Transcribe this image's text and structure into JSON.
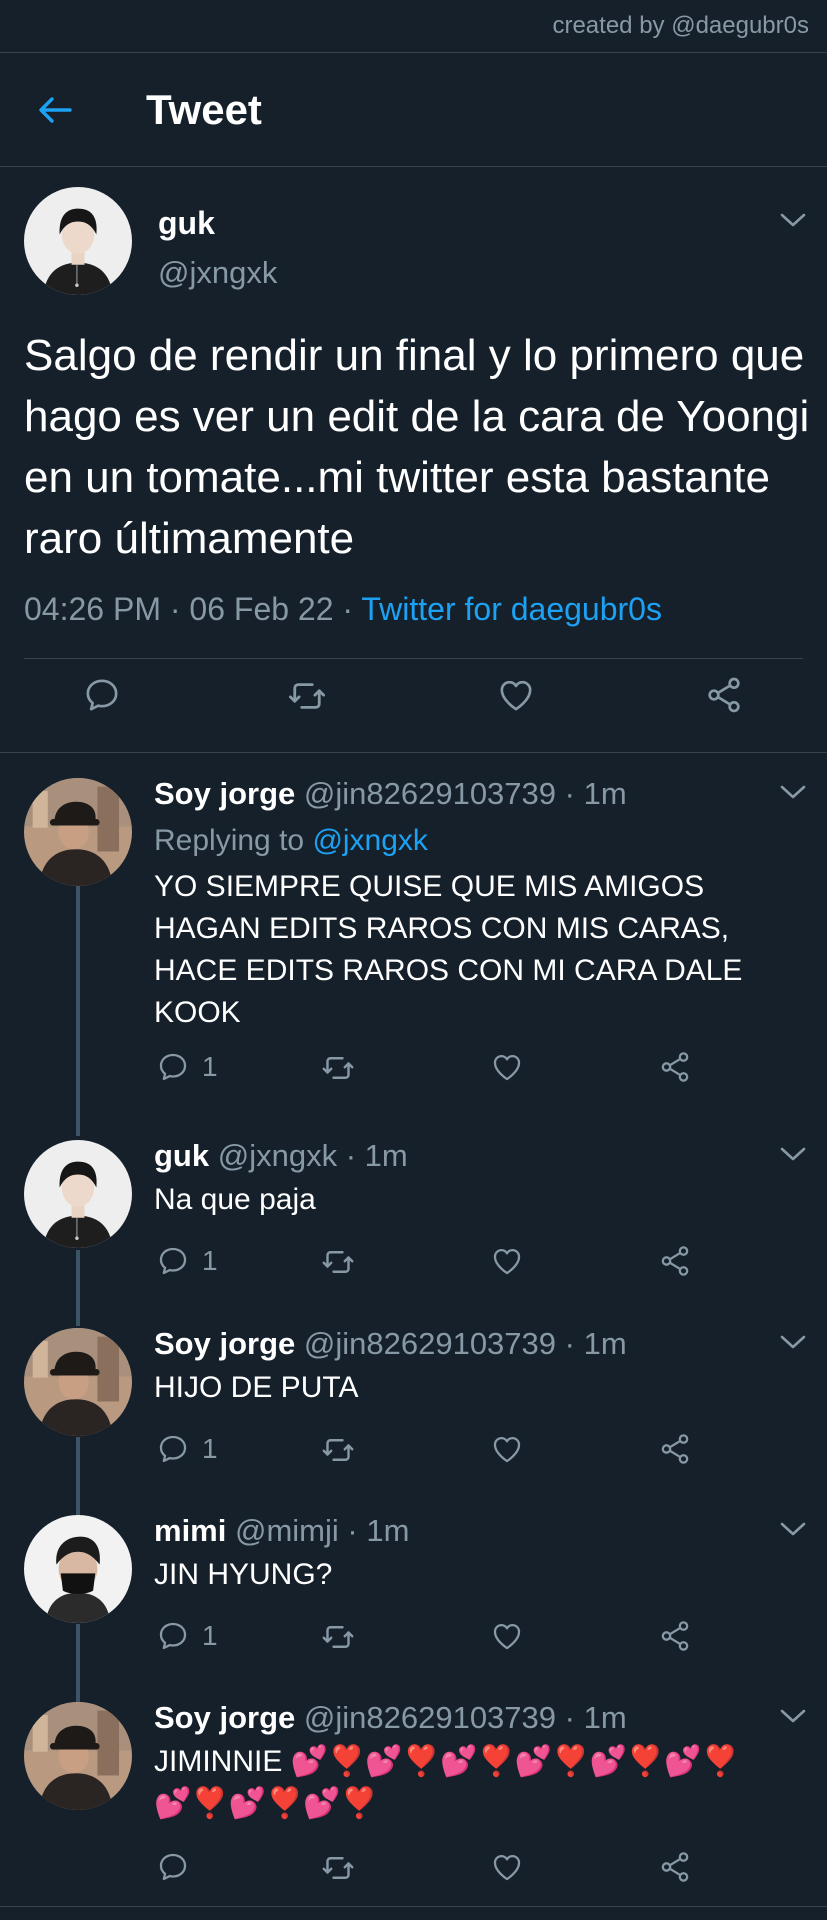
{
  "credit": "created by @daegubr0s",
  "header": {
    "title": "Tweet",
    "back_icon": "arrow-left-icon"
  },
  "colors": {
    "background": "#15202b",
    "accent": "#1da1f2",
    "muted": "#8899a6",
    "divider": "#38444d"
  },
  "main_tweet": {
    "name": "guk",
    "handle": "@jxngxk",
    "text": "Salgo de rendir un final y lo primero que hago es ver un edit de la cara de Yoongi en un tomate...mi twitter esta bastante raro últimamente",
    "time": "04:26 PM",
    "date": "06 Feb 22",
    "source": "Twitter for daegubr0s",
    "separator": "·"
  },
  "replies": [
    {
      "name": "Soy jorge",
      "handle": "@jin82629103739",
      "time": "1m",
      "replying_prefix": "Replying to",
      "replying_to": "@jxngxk",
      "text": "YO SIEMPRE QUISE QUE MIS AMIGOS HAGAN EDITS RAROS CON MIS CARAS, HACE EDITS RAROS CON MI CARA DALE KOOK",
      "reply_count": "1"
    },
    {
      "name": "guk",
      "handle": "@jxngxk",
      "time": "1m",
      "text": "Na que paja",
      "reply_count": "1"
    },
    {
      "name": "Soy jorge",
      "handle": "@jin82629103739",
      "time": "1m",
      "text": "HIJO DE PUTA",
      "reply_count": "1"
    },
    {
      "name": "mimi",
      "handle": "@mimji",
      "time": "1m",
      "text": "JIN HYUNG?",
      "reply_count": "1"
    },
    {
      "name": "Soy jorge",
      "handle": "@jin82629103739",
      "time": "1m",
      "text": "JIMINNIE 💕❣️💕❣️💕❣️💕❣️💕❣️💕❣️💕❣️💕❣️💕❣️",
      "reply_count": ""
    }
  ]
}
